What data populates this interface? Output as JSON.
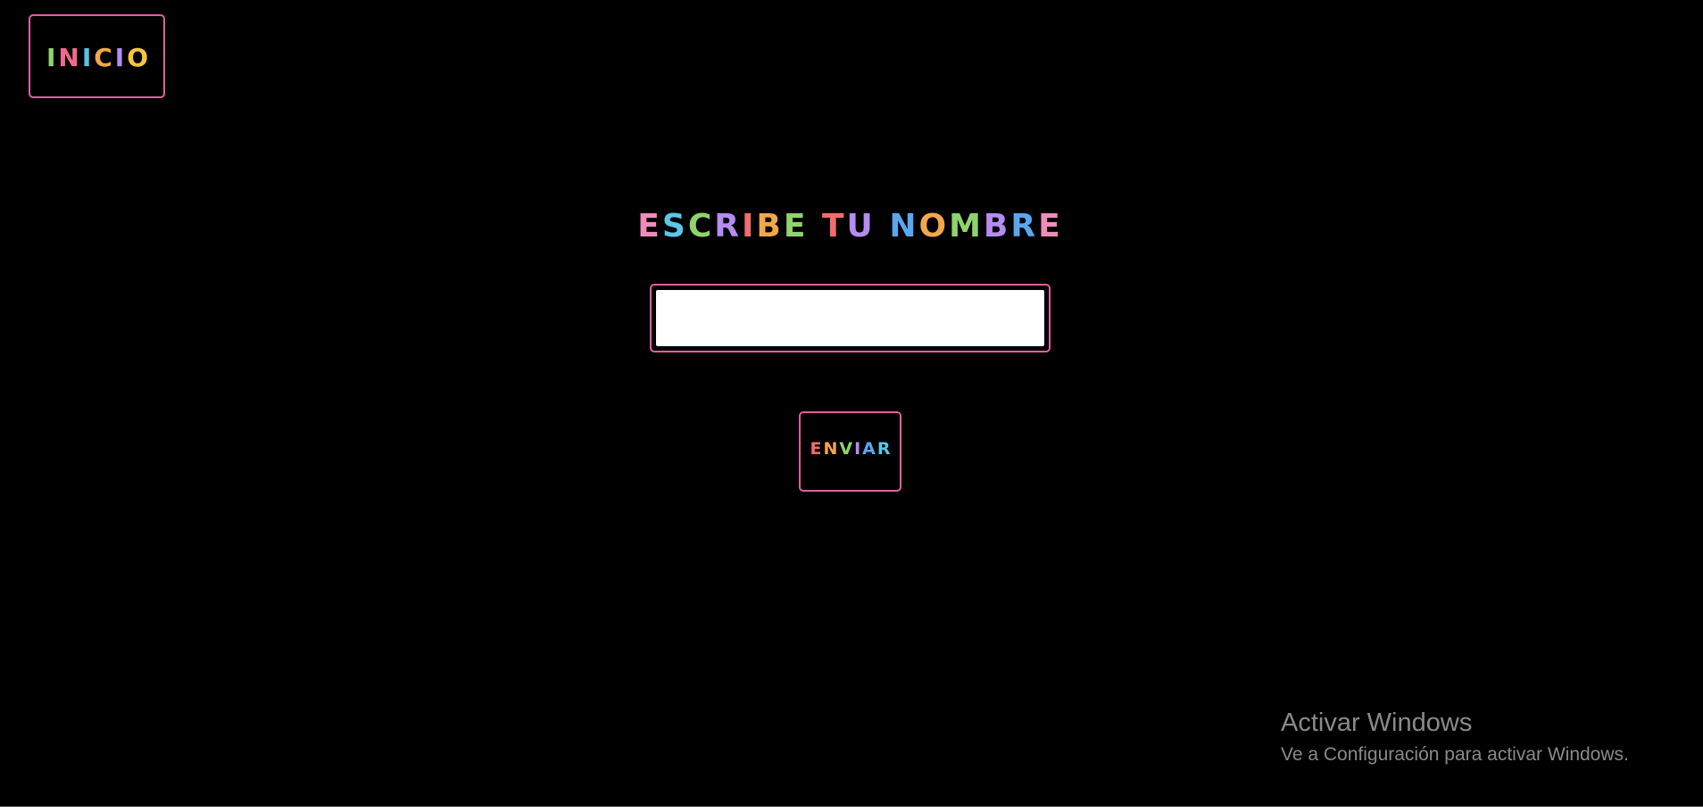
{
  "colors": {
    "background": "#000000",
    "accent_border": "#e0609f",
    "input_background": "#ffffff",
    "notice_text": "#8a8a8a"
  },
  "home_button": {
    "label": "INICIO",
    "letter_colors": [
      "#8fd46b",
      "#f06b8a",
      "#59c3e6",
      "#f2a84a",
      "#b58cf0",
      "#f5c63f"
    ]
  },
  "form": {
    "title": "ESCRIBE TU NOMBRE",
    "title_letter_colors": [
      "#f08cbc",
      "#5cc7e8",
      "#8fd46b",
      "#b58cf0",
      "#f26d6d",
      "#f2a84a",
      "#8fd46b",
      "#ffffff",
      "#f26d6d",
      "#b58cf0",
      "#ffffff",
      "#5aa7f0",
      "#f2a84a",
      "#8fd46b",
      "#b58cf0",
      "#5aa7f0",
      "#f08cbc"
    ],
    "name_input": {
      "value": "",
      "placeholder": ""
    },
    "submit_label": "ENVIAR",
    "submit_letter_colors": [
      "#f26d6d",
      "#f2a84a",
      "#8fd46b",
      "#b58cf0",
      "#5aa7f0",
      "#5cc7e8"
    ]
  },
  "windows_notice": {
    "title": "Activar Windows",
    "subtitle": "Ve a Configuración para activar Windows."
  }
}
